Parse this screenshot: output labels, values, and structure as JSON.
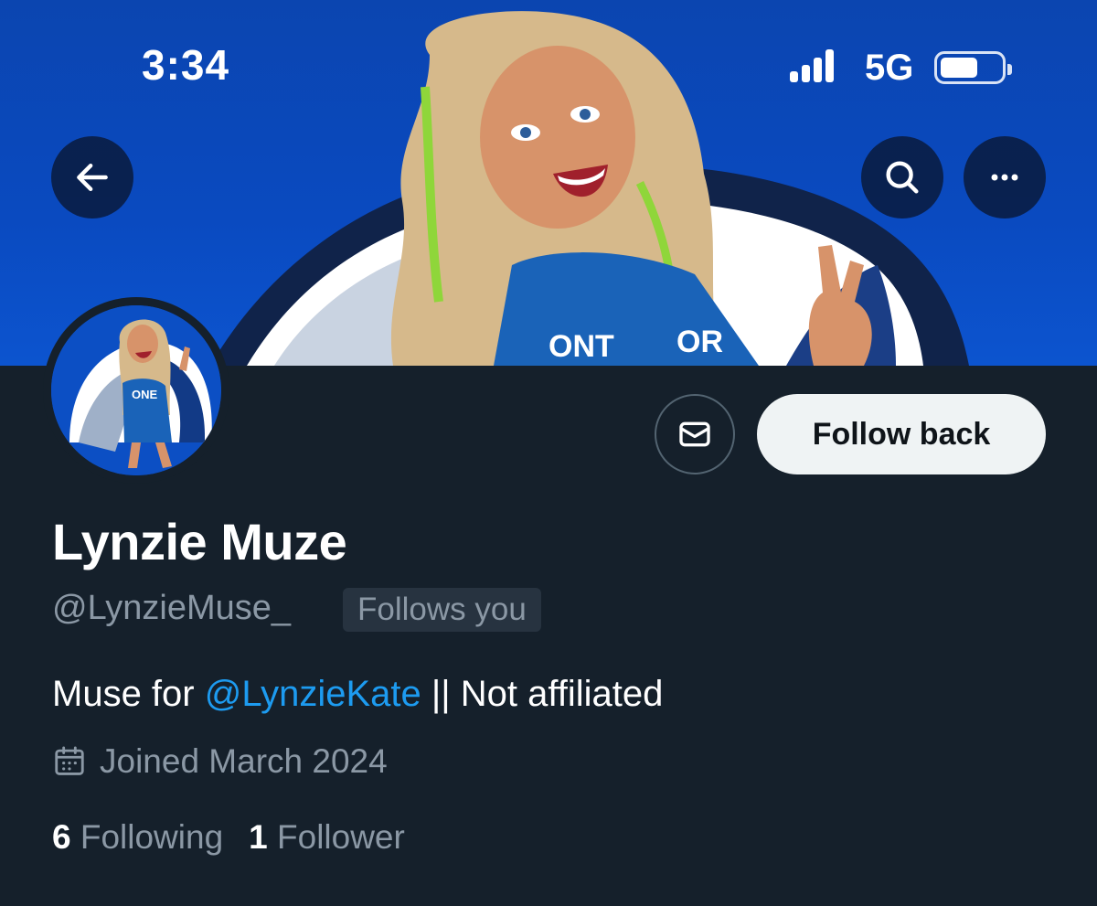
{
  "status_bar": {
    "time": "3:34",
    "network": "5G",
    "battery_level": 0.6
  },
  "header": {
    "back_icon": "arrow-left-icon",
    "search_icon": "search-icon",
    "more_icon": "more-horizontal-icon"
  },
  "actions": {
    "message_icon": "envelope-icon",
    "follow_label": "Follow back"
  },
  "profile": {
    "display_name": "Lynzie Muze",
    "handle": "@LynzieMuse_",
    "follows_you": "Follows you",
    "bio_prefix": "Muse for ",
    "bio_mention": "@LynzieKate",
    "bio_suffix": " || Not affiliated",
    "joined": "Joined March 2024",
    "following_count": "6",
    "following_label": "Following",
    "followers_count": "1",
    "followers_label": "Follower"
  },
  "colors": {
    "background": "#15202b",
    "banner_blue": "#0b45b0",
    "link": "#1d9bf0",
    "secondary_text": "#8b98a5",
    "follow_button_bg": "#eff3f4"
  }
}
